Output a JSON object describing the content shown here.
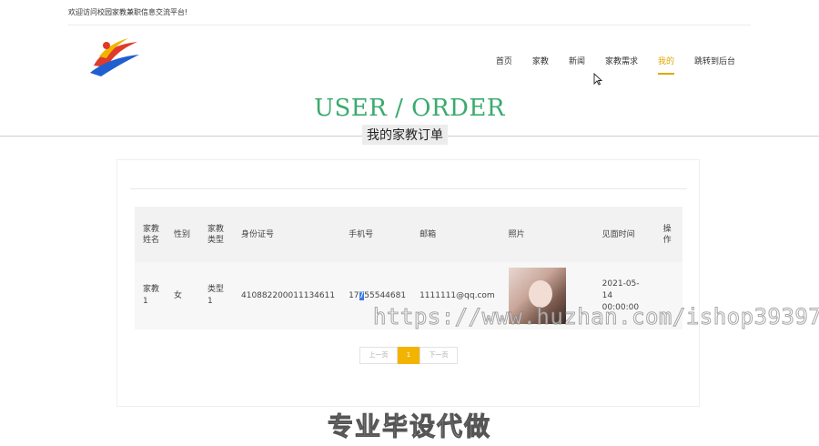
{
  "header": {
    "welcome": "欢迎访问校园家教兼职信息交流平台!"
  },
  "nav": {
    "items": [
      {
        "label": "首页",
        "active": false
      },
      {
        "label": "家教",
        "active": false
      },
      {
        "label": "新闻",
        "active": false
      },
      {
        "label": "家教需求",
        "active": false
      },
      {
        "label": "我的",
        "active": true
      },
      {
        "label": "跳转到后台",
        "active": false
      }
    ]
  },
  "hero": {
    "title": "USER / ORDER",
    "subtitle": "我的家教订单"
  },
  "table": {
    "headers": [
      "家教姓名",
      "性别",
      "家教类型",
      "身份证号",
      "手机号",
      "邮箱",
      "照片",
      "见面时间",
      "操作"
    ],
    "rows": [
      {
        "name": "家教1",
        "gender": "女",
        "type": "类型1",
        "id_number": "410882200011134611",
        "phone_a": "17",
        "phone_b": "7",
        "phone_c": "55544681",
        "email": "1111111@qq.com",
        "meet_time": "2021-05-14 00:00:00",
        "action": ""
      }
    ]
  },
  "pager": {
    "prev": "上一页",
    "current": "1",
    "next": "下一页"
  },
  "watermark": {
    "url": "https://www.huzhan.com/ishop39397",
    "text": "专业毕设代做"
  },
  "colors": {
    "accent": "#e0a800",
    "title_green": "#3aaa6e",
    "page_active": "#f2b400"
  }
}
